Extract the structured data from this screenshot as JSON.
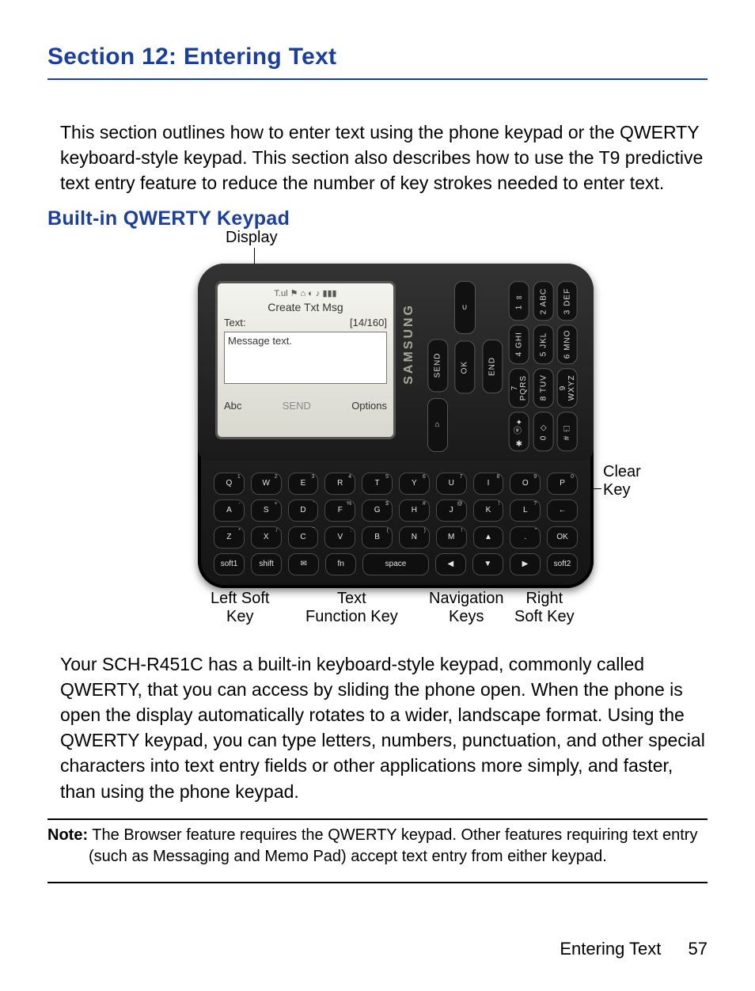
{
  "section_title": "Section 12: Entering Text",
  "intro": "This section outlines how to enter text using the phone keypad or the QWERTY keyboard-style keypad. This section also describes how to use the T9 predictive text entry feature to reduce the number of key strokes needed to enter text.",
  "sub_heading": "Built-in QWERTY Keypad",
  "figure": {
    "labels": {
      "display": "Display",
      "clear_key": "Clear\nKey",
      "left_soft_key": "Left Soft\nKey",
      "text_fn_key": "Text\nFunction Key",
      "nav_keys": "Navigation\nKeys",
      "right_soft_key": "Right\nSoft Key"
    },
    "screen": {
      "status_icons": "T.ul        ⚑ ⌂        ◐  ♪  ▮▮▮",
      "title": "Create Txt Msg",
      "text_label": "Text:",
      "counter": "[14/160]",
      "msg": "Message text.",
      "left_soft": "Abc",
      "mid": "SEND",
      "right_soft": "Options"
    },
    "brand": "SAMSUNG",
    "numpad_cols": [
      [
        "|",
        "SEND",
        "⌂"
      ],
      [
        "∪",
        "OK",
        "|"
      ],
      [
        "1 ∞",
        "4 GHI",
        "7 PQRS",
        "✱ ⓐ✦"
      ],
      [
        "2 ABC",
        "5 JKL",
        "8 TUV",
        "0 ◇"
      ],
      [
        "|",
        "END",
        "3 DEF",
        "6 MNO",
        "9 WXYZ",
        "# ⏍"
      ]
    ],
    "numpad": {
      "col1": [
        "|",
        "SEND",
        "⌂"
      ],
      "col2": [
        "∪",
        "OK",
        "|"
      ],
      "col3": [
        "END",
        "|"
      ],
      "grid": [
        [
          "1 ∞",
          "2 ABC",
          "3 DEF"
        ],
        [
          "4 GHI",
          "5 JKL",
          "6 MNO"
        ],
        [
          "7 PQRS",
          "8 TUV",
          "9 WXYZ"
        ],
        [
          "✱ ⓐ✦",
          "0 ◇",
          "# ⏍"
        ]
      ]
    },
    "qwerty_rows": [
      [
        [
          "Q",
          "1"
        ],
        [
          "W",
          "2"
        ],
        [
          "E",
          "3"
        ],
        [
          "R",
          "4"
        ],
        [
          "T",
          "5"
        ],
        [
          "Y",
          "6"
        ],
        [
          "U",
          "7"
        ],
        [
          "I",
          "8"
        ],
        [
          "O",
          "9"
        ],
        [
          "P",
          "0"
        ]
      ],
      [
        [
          "A",
          "-"
        ],
        [
          "S",
          "+"
        ],
        [
          "D",
          "’"
        ],
        [
          "F",
          "%"
        ],
        [
          "G",
          "$"
        ],
        [
          "H",
          "#"
        ],
        [
          "J",
          "@"
        ],
        [
          "K",
          "!"
        ],
        [
          "L",
          "?"
        ],
        [
          "←",
          ""
        ]
      ],
      [
        [
          "Z",
          "*"
        ],
        [
          "X",
          "/"
        ],
        [
          "C",
          "‾"
        ],
        [
          "V",
          ":"
        ],
        [
          "B",
          "("
        ],
        [
          "N",
          ")"
        ],
        [
          "M",
          "!"
        ],
        [
          "▲",
          ""
        ],
        [
          ".",
          "\""
        ],
        [
          "OK",
          ""
        ]
      ],
      [
        [
          "soft1",
          ""
        ],
        [
          "shift",
          ""
        ],
        [
          "✉",
          ""
        ],
        [
          "fn",
          ""
        ],
        [
          "space",
          ""
        ],
        [
          "◀",
          ""
        ],
        [
          "▼",
          ""
        ],
        [
          "▶",
          ""
        ],
        [
          "soft2",
          ""
        ]
      ]
    ]
  },
  "body_text": "Your SCH-R451C has a built-in keyboard-style keypad, commonly called QWERTY, that you can access by sliding the phone open. When the phone is open the display automatically rotates to a wider, landscape format. Using the QWERTY keypad, you can type letters, numbers, punctuation, and other special characters into text entry fields or other applications more simply, and faster, than using the phone keypad.",
  "note_label": "Note:",
  "note_text": " The Browser feature requires the QWERTY keypad. Other features requiring text entry (such as Messaging and Memo Pad) accept text entry from either keypad.",
  "footer_label": "Entering Text",
  "page_number": "57"
}
